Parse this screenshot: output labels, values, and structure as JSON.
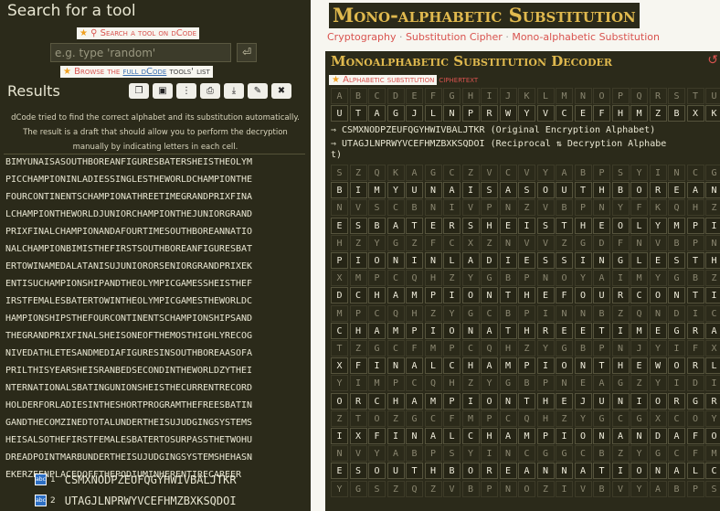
{
  "sidebar": {
    "search_title": "Search for a tool",
    "search_link": "Search a tool on dCode",
    "search_placeholder": "e.g. type 'random'",
    "browse_prefix": "Browse the",
    "browse_link": "full dCode",
    "browse_suffix": "tools' list",
    "results_title": "Results",
    "toolbar_icons": [
      "copy-icon",
      "save-icon",
      "grip-icon",
      "print-icon",
      "download-icon",
      "pin-icon",
      "close-icon"
    ],
    "info_text": "dCode tried to find the correct alphabet and its substitution automatically. The result is a draft that should allow you to perform the decryption manually by indicating letters in each cell.",
    "result_lines": [
      "BIMYUNAISASOUTHBOREANFIGURESBATERSHEISTHEOLYM",
      "PICCHAMPIONINLADIESSINGLESTHEWORLDCHAMPIONTHE",
      "FOURCONTINENTSCHAMPIONATHREETIMEGRANDPRIXFINA",
      "LCHAMPIONTHEWORLDJUNIORCHAMPIONTHEJUNIORGRAND",
      "PRIXFINALCHAMPIONANDAFOURTIMESOUTHBOREANNATIO",
      "NALCHAMPIONBIMISTHEFIRSTSOUTHBOREANFIGURESBAT",
      "ERTOWINAMEDALATANISUJUNIORORSENIORGRANDPRIXEK",
      "ENTISUCHAMPIONSHIPANDTHEOLYMPICGAMESSHEISTHEF",
      "IRSTFEMALESBATERTOWINTHEOLYMPICGAMESTHEWORLDC",
      "HAMPIONSHIPSTHEFOURCONTINENTSCHAMPIONSHIPSAND",
      "THEGRANDPRIXFINALSHEISONEOFTHEMOSTHIGHLYRECOG",
      "NIVEDATHLETESANDMEDIAFIGURESINSOUTHBOREAASOFA",
      "PRILTHISYEARSHEISRANBEDSECONDINTHEWORLDZYTHEI",
      "NTERNATIONALSBATINGUNIONSHEISTHECURRENTRECORD",
      "HOLDERFORLADIESINTHESHORTPROGRAMTHEFREESBATIN",
      "GANDTHECOMZINEDTOTALUNDERTHEISUJUDGINGSYSTEMS",
      "HEISALSOTHEFIRSTFEMALESBATERTOSURPASSTHETWOHU",
      "DREADPOINTMARBUNDERTHEISUJUDGINGSYSTEMSHEHASN",
      "EKERZEENPLACEDOFFTHEPODIUMINHERENTIRECAREER"
    ],
    "alphabets": [
      {
        "num": "1",
        "text": "CSMXNODPZEUFQGYHWIVBALJTKR"
      },
      {
        "num": "2",
        "text": "UTAGJLNPRWYVCEFHMZBXKSQDOI"
      }
    ]
  },
  "main": {
    "title": "Mono-alphabetic Substitution",
    "breadcrumbs": [
      "Cryptography",
      "Substitution Cipher",
      "Mono-alphabetic Substitution"
    ],
    "panel_title": "Monoalphabetic Substitution Decoder",
    "alphabet_label": "Alphabetic substitution",
    "ciphertext_label": "ciphertext",
    "plain_alphabet": "ABCDEFGHIJKLMNOPQRSTUVWXYZ",
    "cipher_alphabet": "UTAGJLNPRWYVCEFHMZBXKSQDOI",
    "eq1": "⇒ CSMXNODPZEUFQGYHWIVBALJTKR (Original Encryption Alphabet)",
    "eq2a": "⇒ UTAGJLNPRWYVCEFHMZBXKSQDOI (Reciprocal ⇅ Decryption Alphabe",
    "eq2b": "t)",
    "cipher_rows": [
      "SZQKAGCZVCVYABPSYINCGOZDAI",
      "NVSCBNIVPNZVBPNYFKQHZMMPCQ",
      "HZYGZFCXZNVVZGDFNVBPNJYIF",
      "XMPCQHZYGBPNOYAIMYGBZGNGBV",
      "MPCQHZYGCBPINNBZQNDICGXHIZ",
      "TZGCFMPCQHZYGBPNJYIFXEAGZ",
      "YIMPCQHZYGBPNEAGZYIDICGXHI",
      "ZTOZGCFMPCQHZYGCGXCOYAIBZQ",
      "NVYABPSYINCGGCBZYGCFMPCQHZ",
      "YGSZQZVBPNOZIVBVYABPSYINCG"
    ],
    "plain_rows": [
      "BIMYUNAISASOUTHBOREANFIGUR",
      "ESBATERSHEISTHEOLYMPICCHAM",
      "PIONINLADIESSINGLESTHEWORL",
      "DCHAMPIONTHEFOURCONTINENTS",
      "CHAMPIONATHREETIMEGRANDPRI",
      "XFINALCHAMPIONTHEWORLDJUNI",
      "ORCHAMPIONTHEJUNIORGRANDPR",
      "IXFINALCHAMPIONANDAFOURTIM",
      "ESOUTHBOREANNATIONALCHAMPI"
    ]
  }
}
